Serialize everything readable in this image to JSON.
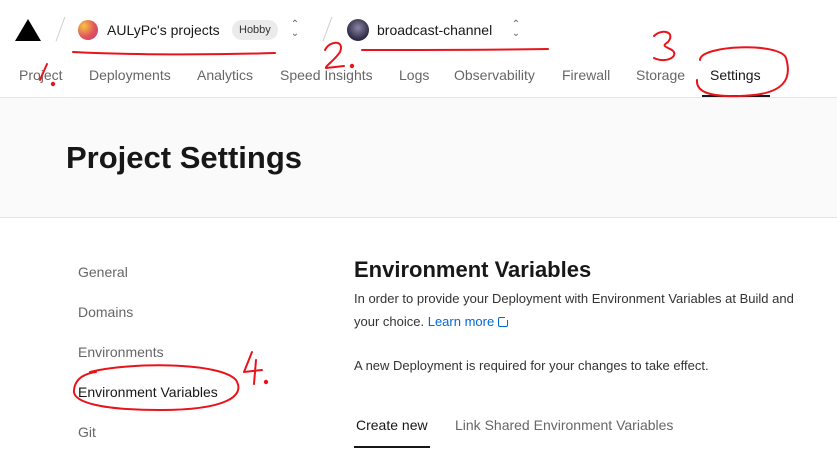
{
  "topbar": {
    "team_name": "AULyPc's projects",
    "team_badge": "Hobby",
    "project_name": "broadcast-channel"
  },
  "tabs": [
    {
      "label": "Project"
    },
    {
      "label": "Deployments"
    },
    {
      "label": "Analytics"
    },
    {
      "label": "Speed Insights"
    },
    {
      "label": "Logs"
    },
    {
      "label": "Observability"
    },
    {
      "label": "Firewall"
    },
    {
      "label": "Storage"
    },
    {
      "label": "Settings",
      "active": true
    }
  ],
  "page_title": "Project Settings",
  "sidebar": {
    "items": [
      {
        "label": "General"
      },
      {
        "label": "Domains"
      },
      {
        "label": "Environments"
      },
      {
        "label": "Environment Variables",
        "active": true
      },
      {
        "label": "Git"
      }
    ]
  },
  "main": {
    "title": "Environment Variables",
    "desc_line1": "In order to provide your Deployment with Environment Variables at Build and",
    "desc_line2_prefix": "your choice.",
    "learn_more": "Learn more",
    "notice": "A new Deployment is required for your changes to take effect.",
    "subtabs": [
      {
        "label": "Create new",
        "active": true
      },
      {
        "label": "Link Shared Environment Variables"
      }
    ]
  },
  "annotations": {
    "numbers": [
      "1.",
      "2.",
      "3",
      "4."
    ],
    "color": "#e8141b"
  },
  "colors": {
    "link": "#0068d6",
    "text": "#171717",
    "muted": "#666666"
  }
}
